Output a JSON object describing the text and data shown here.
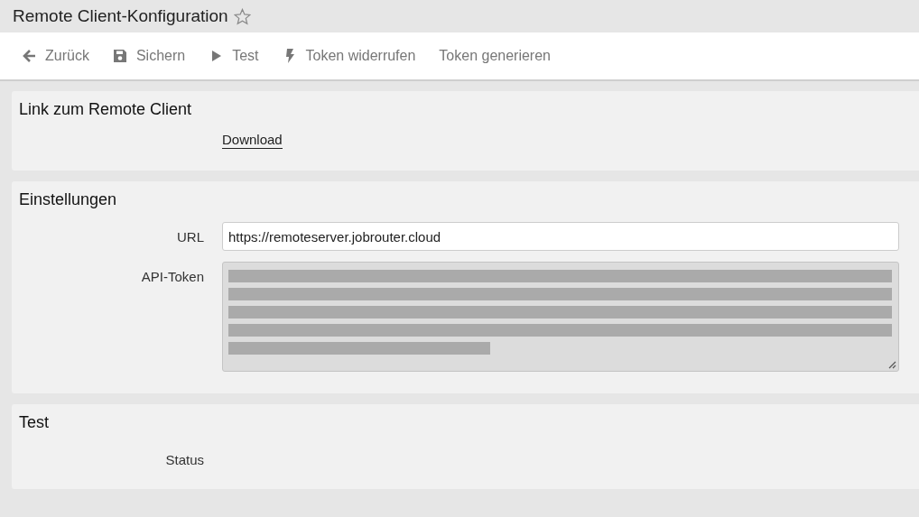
{
  "window": {
    "title": "Remote Client-Konfiguration",
    "favorite": false
  },
  "toolbar": [
    {
      "label": "Zurück",
      "kind": "back"
    },
    {
      "label": "Sichern",
      "kind": "save"
    },
    {
      "label": "Test",
      "kind": "run"
    },
    {
      "label": "Token widerrufen",
      "kind": "revoke"
    },
    {
      "label": "Token generieren",
      "kind": "plain"
    }
  ],
  "sections": [
    {
      "title": "Link zum Remote Client",
      "rows": [
        {
          "kind": "link",
          "label": "",
          "value": "Download"
        }
      ]
    },
    {
      "title": "Einstellungen",
      "rows": [
        {
          "kind": "input",
          "label": "URL",
          "value": "https://remoteserver.jobrouter.cloud"
        },
        {
          "kind": "redacted",
          "label": "API-Token",
          "disabled": true
        }
      ]
    },
    {
      "title": "Test",
      "rows": [
        {
          "kind": "empty",
          "label": "Status"
        }
      ]
    }
  ]
}
